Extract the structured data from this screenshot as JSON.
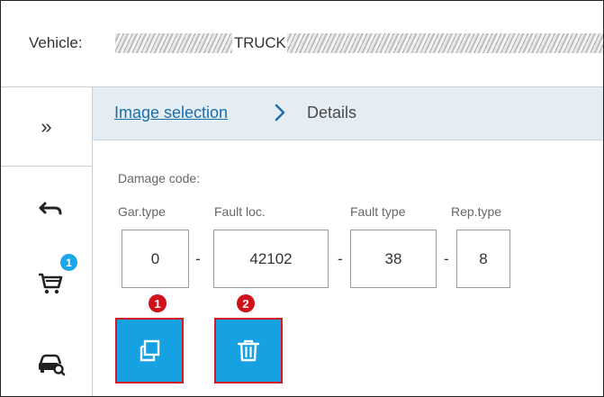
{
  "vehicle": {
    "label": "Vehicle:",
    "model": "TRUCK,"
  },
  "rail": {
    "expand_glyph": "»",
    "cart_badge": "1",
    "icons": [
      "expand-icon",
      "back-arrow-icon",
      "cart-icon",
      "vehicle-search-icon"
    ]
  },
  "breadcrumb": {
    "link": "Image selection",
    "current": "Details"
  },
  "damage": {
    "label": "Damage code:",
    "columns": [
      "Gar.type",
      "Fault loc.",
      "Fault type",
      "Rep.type"
    ],
    "values": [
      "0",
      "42102",
      "38",
      "8"
    ],
    "separator": "-"
  },
  "actions": {
    "markers": [
      "1",
      "2"
    ],
    "icons": [
      "copy-icon",
      "delete-icon"
    ]
  },
  "colors": {
    "accent": "#16a1e2",
    "marker": "#d0111b",
    "breadcrumb_bg": "#e4edf4",
    "link": "#1a6ea8"
  }
}
